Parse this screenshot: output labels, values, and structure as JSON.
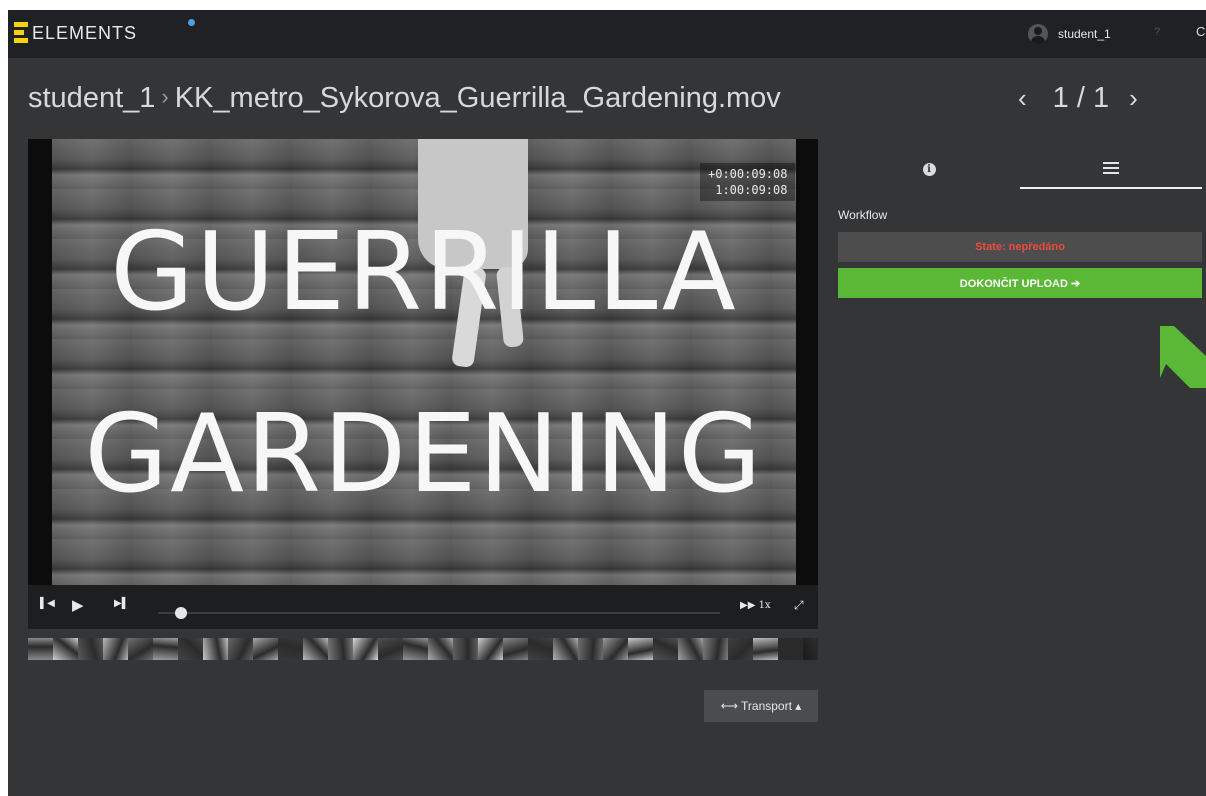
{
  "app": {
    "logo_text": "ELEMENTS",
    "user_name": "student_1",
    "help_label": "?",
    "settings_label": "C"
  },
  "breadcrumb": {
    "parent": "student_1",
    "separator": "›",
    "current": "KK_metro_Sykorova_Guerrilla_Gardening.mov"
  },
  "pager": {
    "prev": "‹",
    "count": "1 / 1",
    "next": "›"
  },
  "video": {
    "title_line1": "GUERRILLA",
    "title_line2": "GARDENING",
    "timecode_offset": "+0:00:09:08",
    "timecode_absolute": "1:00:09:08",
    "playback_progress": 0.018
  },
  "controls": {
    "skip_back": "◀",
    "play": "▶",
    "skip_forward": "▶",
    "speed": "1x",
    "fullscreen": "⤢"
  },
  "transport": {
    "label": "⟷ Transport ▴"
  },
  "panel": {
    "info_tab_icon": "info-icon",
    "workflow_tab_icon": "list-icon",
    "workflow_heading": "Workflow",
    "state_text": "State: nepředáno",
    "upload_label": "DOKONČIT UPLOAD ➔"
  },
  "colors": {
    "accent_green": "#5ab836",
    "state_red": "#e84c3d",
    "logo_yellow": "#f3d40e",
    "status_dot": "#4f9ee0"
  }
}
